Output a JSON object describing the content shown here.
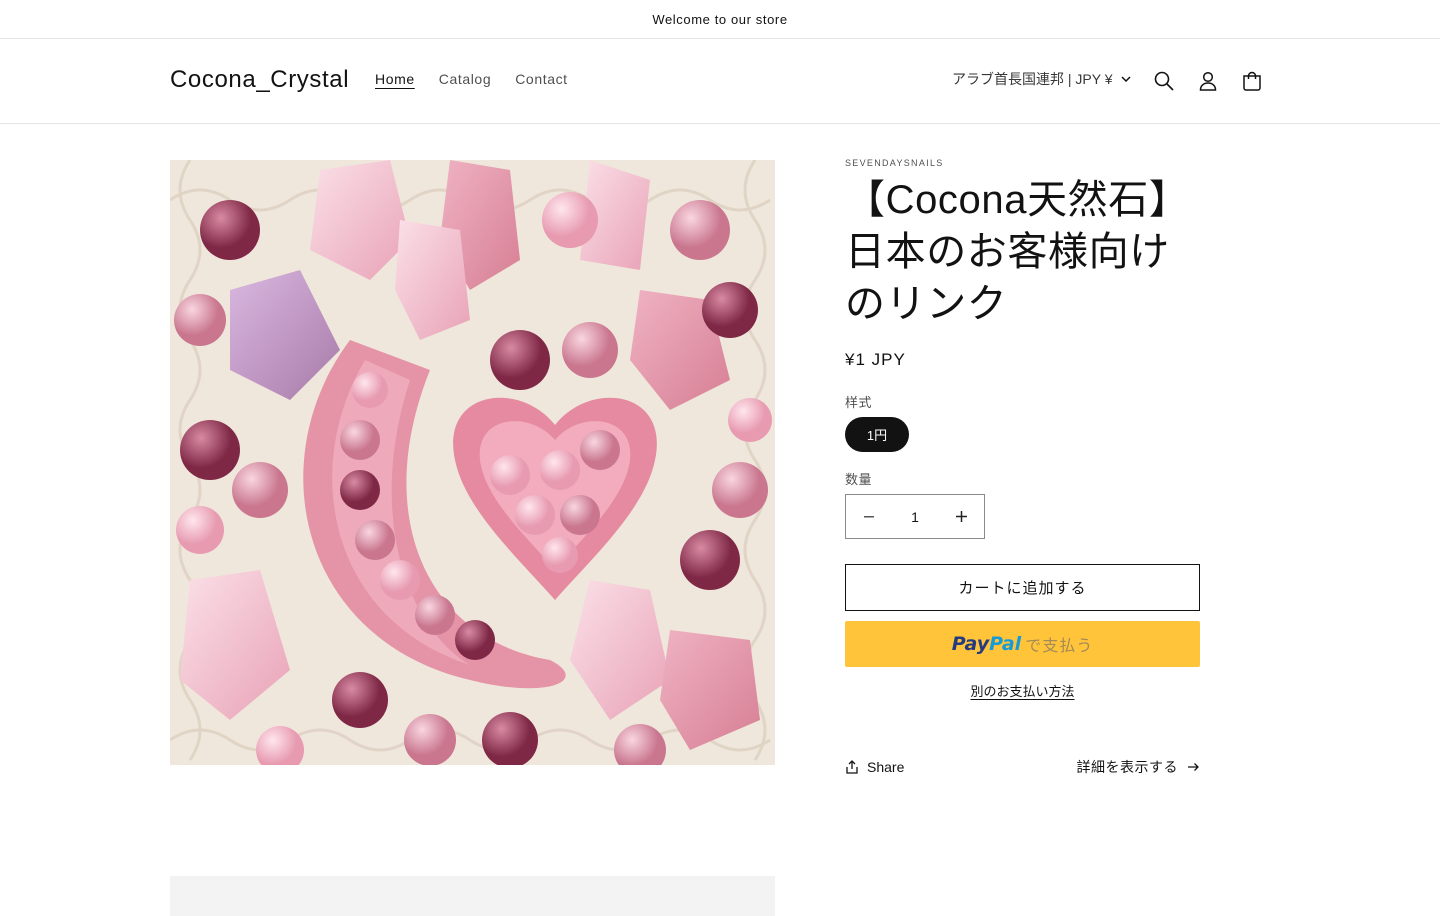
{
  "announcement": "Welcome to our store",
  "header": {
    "logo": "Cocona_Crystal",
    "nav": [
      "Home",
      "Catalog",
      "Contact"
    ],
    "active_nav": "Home",
    "country": "アラブ首長国連邦 | JPY ¥",
    "icons": [
      "search-icon",
      "account-icon",
      "cart-icon",
      "chevron-down-icon"
    ]
  },
  "product": {
    "vendor": "SEVENDAYSNAILS",
    "title": "【Cocona天然石】日本のお客様向けのリンク",
    "price": "¥1 JPY",
    "variant_label": "样式",
    "variant_selected": "1円",
    "quantity_label": "数量",
    "quantity": "1",
    "add_to_cart": "カートに追加する",
    "paypal_brand_1": "Pay",
    "paypal_brand_2": "Pal",
    "paypal_suffix": "で支払う",
    "more_payment": "別のお支払い方法",
    "share": "Share",
    "details": "詳細を表示する"
  },
  "colors": {
    "text": "#121212",
    "paypal_bg": "#ffc43a",
    "paypal_dark": "#253b80",
    "paypal_light": "#179bd7",
    "pill_bg": "#121212"
  }
}
